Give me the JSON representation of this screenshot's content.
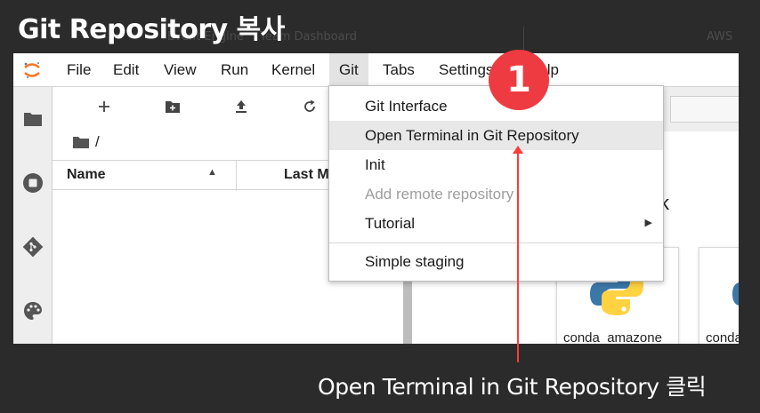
{
  "title": "Git Repository 복사",
  "background_text": [
    "Event Engine",
    "Team Dashboard",
    "AWS"
  ],
  "menubar": {
    "items": [
      "File",
      "Edit",
      "View",
      "Run",
      "Kernel",
      "Git",
      "Tabs",
      "Settings",
      "Help"
    ],
    "active": "Git"
  },
  "git_menu": {
    "items": [
      {
        "label": "Git Interface",
        "state": "normal"
      },
      {
        "label": "Open Terminal in Git Repository",
        "state": "highlighted"
      },
      {
        "label": "Init",
        "state": "normal"
      },
      {
        "label": "Add remote repository",
        "state": "disabled"
      },
      {
        "label": "Tutorial",
        "state": "submenu"
      },
      {
        "label": "Simple staging",
        "state": "normal"
      }
    ]
  },
  "file_browser": {
    "toolbar_icons": [
      "plus-icon",
      "new-folder-icon",
      "upload-icon",
      "refresh-icon"
    ],
    "breadcrumb": "/",
    "columns": {
      "name": "Name",
      "last_modified": "Last M"
    }
  },
  "sidebar_icons": [
    "folder-icon",
    "stop-circle-icon",
    "git-icon",
    "palette-icon"
  ],
  "launcher": {
    "partial_heading": "k",
    "cards": [
      {
        "label": "conda_amazone",
        "icon": "python-logo-icon"
      },
      {
        "label": "conda",
        "icon": "python-logo-icon"
      }
    ]
  },
  "step_badge": "1",
  "caption": "Open Terminal in Git Repository 클릭",
  "colors": {
    "badge": "#ee3b41",
    "callout": "#ff3a3a",
    "slide_bg": "#2b2b2b"
  }
}
